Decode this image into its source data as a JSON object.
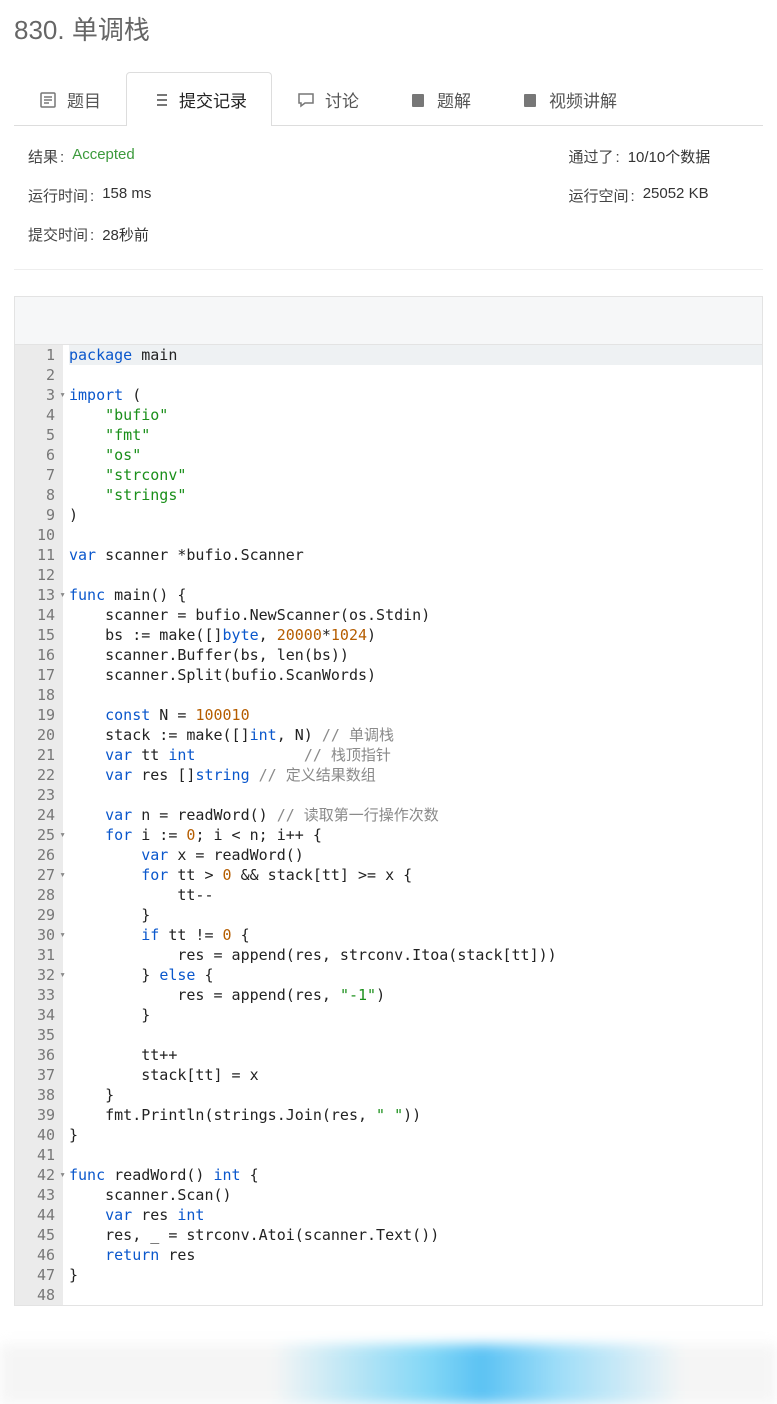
{
  "title": "830. 单调栈",
  "tabs": {
    "problem": "题目",
    "submissions": "提交记录",
    "discuss": "讨论",
    "solution": "题解",
    "video": "视频讲解"
  },
  "result": {
    "label_result": "结果",
    "value_result": "Accepted",
    "label_pass": "通过了",
    "value_pass": "10/10个数据",
    "label_time": "运行时间",
    "value_time": "158 ms",
    "label_space": "运行空间",
    "value_space": "25052 KB",
    "label_submit": "提交时间",
    "value_submit": "28秒前"
  },
  "lines": [
    {
      "n": 1,
      "hl": true,
      "fold": false,
      "tokens": [
        [
          "kw",
          "package"
        ],
        [
          "",
          " main"
        ]
      ]
    },
    {
      "n": 2,
      "tokens": []
    },
    {
      "n": 3,
      "fold": true,
      "tokens": [
        [
          "kw",
          "import"
        ],
        [
          "",
          " ("
        ]
      ]
    },
    {
      "n": 4,
      "tokens": [
        [
          "",
          "    "
        ],
        [
          "str",
          "\"bufio\""
        ]
      ]
    },
    {
      "n": 5,
      "tokens": [
        [
          "",
          "    "
        ],
        [
          "str",
          "\"fmt\""
        ]
      ]
    },
    {
      "n": 6,
      "tokens": [
        [
          "",
          "    "
        ],
        [
          "str",
          "\"os\""
        ]
      ]
    },
    {
      "n": 7,
      "tokens": [
        [
          "",
          "    "
        ],
        [
          "str",
          "\"strconv\""
        ]
      ]
    },
    {
      "n": 8,
      "tokens": [
        [
          "",
          "    "
        ],
        [
          "str",
          "\"strings\""
        ]
      ]
    },
    {
      "n": 9,
      "tokens": [
        [
          "",
          ")"
        ]
      ]
    },
    {
      "n": 10,
      "tokens": []
    },
    {
      "n": 11,
      "tokens": [
        [
          "kw",
          "var"
        ],
        [
          "",
          " scanner *bufio.Scanner"
        ]
      ]
    },
    {
      "n": 12,
      "tokens": []
    },
    {
      "n": 13,
      "fold": true,
      "tokens": [
        [
          "kw",
          "func"
        ],
        [
          "",
          " main() {"
        ]
      ]
    },
    {
      "n": 14,
      "tokens": [
        [
          "",
          "    scanner = bufio.NewScanner(os.Stdin)"
        ]
      ]
    },
    {
      "n": 15,
      "tokens": [
        [
          "",
          "    bs := make([]"
        ],
        [
          "typ",
          "byte"
        ],
        [
          "",
          ", "
        ],
        [
          "num",
          "20000"
        ],
        [
          "",
          "*"
        ],
        [
          "num",
          "1024"
        ],
        [
          "",
          ")"
        ]
      ]
    },
    {
      "n": 16,
      "tokens": [
        [
          "",
          "    scanner.Buffer(bs, len(bs))"
        ]
      ]
    },
    {
      "n": 17,
      "tokens": [
        [
          "",
          "    scanner.Split(bufio.ScanWords)"
        ]
      ]
    },
    {
      "n": 18,
      "tokens": []
    },
    {
      "n": 19,
      "tokens": [
        [
          "",
          "    "
        ],
        [
          "kw",
          "const"
        ],
        [
          "",
          " N = "
        ],
        [
          "num",
          "100010"
        ]
      ]
    },
    {
      "n": 20,
      "tokens": [
        [
          "",
          "    stack := make([]"
        ],
        [
          "typ",
          "int"
        ],
        [
          "",
          ", N) "
        ],
        [
          "com",
          "// 单调栈"
        ]
      ]
    },
    {
      "n": 21,
      "tokens": [
        [
          "",
          "    "
        ],
        [
          "kw",
          "var"
        ],
        [
          "",
          " tt "
        ],
        [
          "typ",
          "int"
        ],
        [
          "",
          "            "
        ],
        [
          "com",
          "// 栈顶指针"
        ]
      ]
    },
    {
      "n": 22,
      "tokens": [
        [
          "",
          "    "
        ],
        [
          "kw",
          "var"
        ],
        [
          "",
          " res []"
        ],
        [
          "typ",
          "string"
        ],
        [
          "",
          " "
        ],
        [
          "com",
          "// 定义结果数组"
        ]
      ]
    },
    {
      "n": 23,
      "tokens": []
    },
    {
      "n": 24,
      "tokens": [
        [
          "",
          "    "
        ],
        [
          "kw",
          "var"
        ],
        [
          "",
          " n = readWord() "
        ],
        [
          "com",
          "// 读取第一行操作次数"
        ]
      ]
    },
    {
      "n": 25,
      "fold": true,
      "tokens": [
        [
          "",
          "    "
        ],
        [
          "kw",
          "for"
        ],
        [
          "",
          " i := "
        ],
        [
          "num",
          "0"
        ],
        [
          "",
          "; i < n; i++ {"
        ]
      ]
    },
    {
      "n": 26,
      "tokens": [
        [
          "",
          "        "
        ],
        [
          "kw",
          "var"
        ],
        [
          "",
          " x = readWord()"
        ]
      ]
    },
    {
      "n": 27,
      "fold": true,
      "tokens": [
        [
          "",
          "        "
        ],
        [
          "kw",
          "for"
        ],
        [
          "",
          " tt > "
        ],
        [
          "num",
          "0"
        ],
        [
          "",
          " && stack[tt] >= x {"
        ]
      ]
    },
    {
      "n": 28,
      "tokens": [
        [
          "",
          "            tt--"
        ]
      ]
    },
    {
      "n": 29,
      "tokens": [
        [
          "",
          "        }"
        ]
      ]
    },
    {
      "n": 30,
      "fold": true,
      "tokens": [
        [
          "",
          "        "
        ],
        [
          "kw",
          "if"
        ],
        [
          "",
          " tt != "
        ],
        [
          "num",
          "0"
        ],
        [
          "",
          " {"
        ]
      ]
    },
    {
      "n": 31,
      "tokens": [
        [
          "",
          "            res = append(res, strconv.Itoa(stack[tt]))"
        ]
      ]
    },
    {
      "n": 32,
      "fold": true,
      "tokens": [
        [
          "",
          "        } "
        ],
        [
          "kw",
          "else"
        ],
        [
          "",
          " {"
        ]
      ]
    },
    {
      "n": 33,
      "tokens": [
        [
          "",
          "            res = append(res, "
        ],
        [
          "str",
          "\"-1\""
        ],
        [
          "",
          ")"
        ]
      ]
    },
    {
      "n": 34,
      "tokens": [
        [
          "",
          "        }"
        ]
      ]
    },
    {
      "n": 35,
      "tokens": []
    },
    {
      "n": 36,
      "tokens": [
        [
          "",
          "        tt++"
        ]
      ]
    },
    {
      "n": 37,
      "tokens": [
        [
          "",
          "        stack[tt] = x"
        ]
      ]
    },
    {
      "n": 38,
      "tokens": [
        [
          "",
          "    }"
        ]
      ]
    },
    {
      "n": 39,
      "tokens": [
        [
          "",
          "    fmt.Println(strings.Join(res, "
        ],
        [
          "str",
          "\" \""
        ],
        [
          "",
          ")"
        ],
        [
          "",
          ")"
        ]
      ]
    },
    {
      "n": 40,
      "tokens": [
        [
          "",
          "}"
        ]
      ]
    },
    {
      "n": 41,
      "tokens": []
    },
    {
      "n": 42,
      "fold": true,
      "tokens": [
        [
          "kw",
          "func"
        ],
        [
          "",
          " readWord() "
        ],
        [
          "typ",
          "int"
        ],
        [
          "",
          " {"
        ]
      ]
    },
    {
      "n": 43,
      "tokens": [
        [
          "",
          "    scanner.Scan()"
        ]
      ]
    },
    {
      "n": 44,
      "tokens": [
        [
          "",
          "    "
        ],
        [
          "kw",
          "var"
        ],
        [
          "",
          " res "
        ],
        [
          "typ",
          "int"
        ]
      ]
    },
    {
      "n": 45,
      "tokens": [
        [
          "",
          "    res, _ = strconv.Atoi(scanner.Text())"
        ]
      ]
    },
    {
      "n": 46,
      "tokens": [
        [
          "",
          "    "
        ],
        [
          "kw",
          "return"
        ],
        [
          "",
          " res"
        ]
      ]
    },
    {
      "n": 47,
      "tokens": [
        [
          "",
          "}"
        ]
      ]
    },
    {
      "n": 48,
      "tokens": []
    }
  ]
}
